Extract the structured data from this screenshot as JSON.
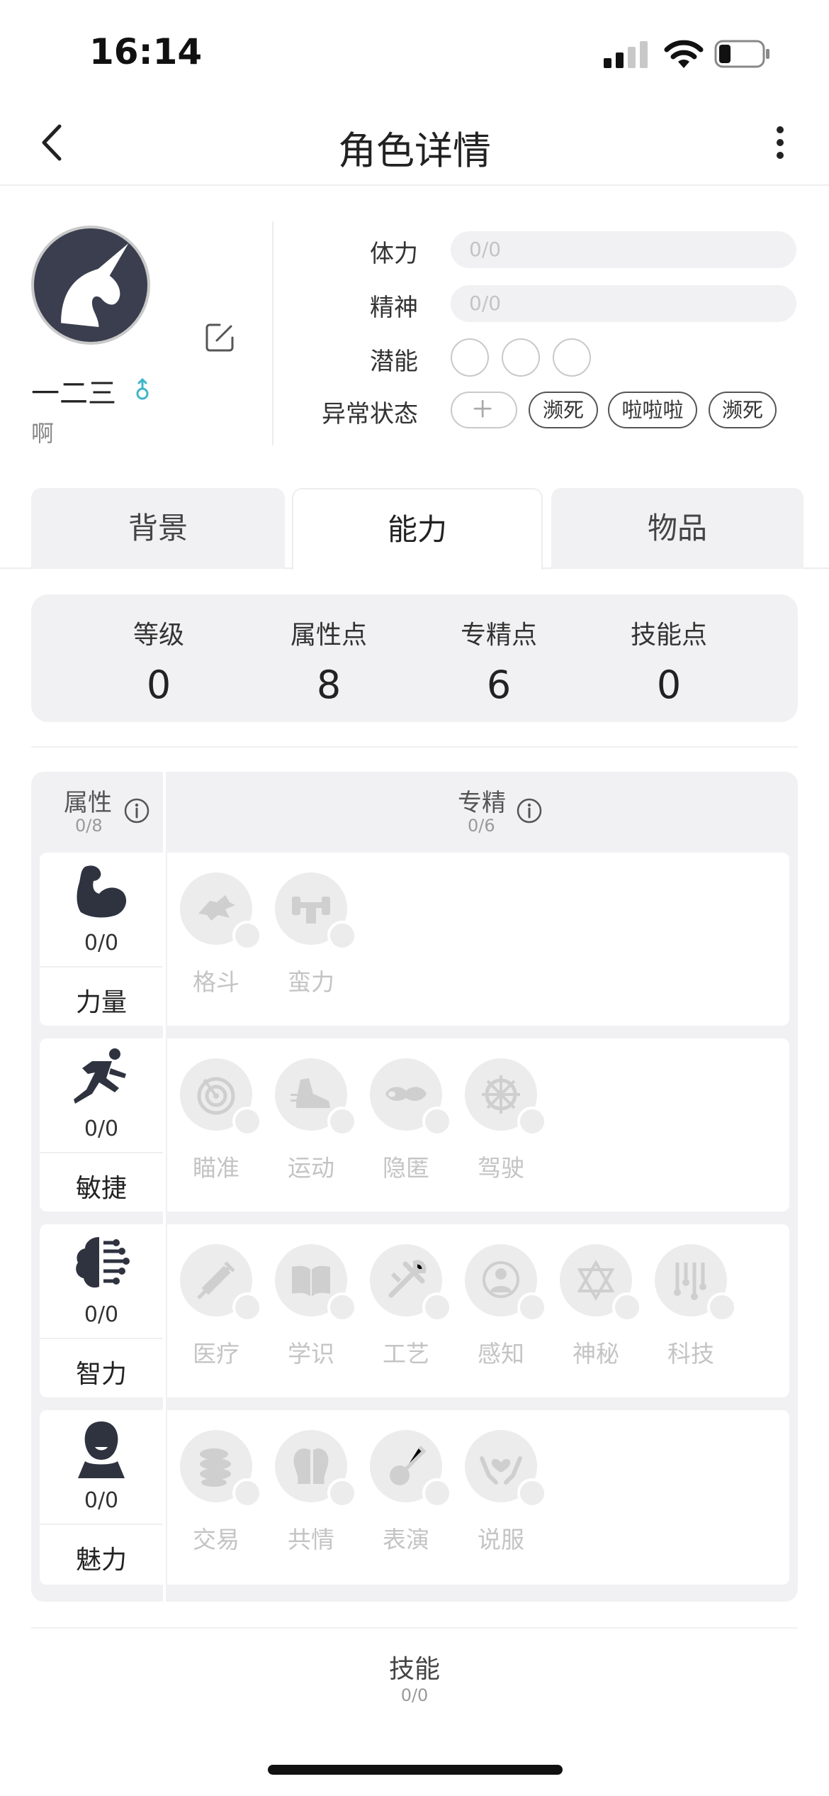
{
  "status_bar": {
    "time": "16:14"
  },
  "nav": {
    "title": "角色详情"
  },
  "profile": {
    "name": "一二三",
    "gender_symbol": "♂",
    "description": "啊"
  },
  "stats": {
    "stamina": {
      "label": "体力",
      "value": "0/0"
    },
    "spirit": {
      "label": "精神",
      "value": "0/0"
    },
    "potential": {
      "label": "潜能",
      "slots": 3
    },
    "status": {
      "label": "异常状态",
      "tags": [
        "濒死",
        "啦啦啦",
        "濒死"
      ]
    }
  },
  "tabs": [
    "背景",
    "能力",
    "物品"
  ],
  "active_tab": "能力",
  "summary": [
    {
      "label": "等级",
      "value": "0"
    },
    {
      "label": "属性点",
      "value": "8"
    },
    {
      "label": "专精点",
      "value": "6"
    },
    {
      "label": "技能点",
      "value": "0"
    }
  ],
  "grid": {
    "attr_header": {
      "title": "属性",
      "sub": "0/8"
    },
    "spec_header": {
      "title": "专精",
      "sub": "0/6"
    },
    "rows": [
      {
        "name": "力量",
        "value": "0/0",
        "icon": "muscle-icon",
        "skills": [
          {
            "name": "格斗",
            "icon": "fist-icon"
          },
          {
            "name": "蛮力",
            "icon": "weightlift-icon"
          }
        ]
      },
      {
        "name": "敏捷",
        "value": "0/0",
        "icon": "runner-icon",
        "skills": [
          {
            "name": "瞄准",
            "icon": "target-icon"
          },
          {
            "name": "运动",
            "icon": "sneaker-icon"
          },
          {
            "name": "隐匿",
            "icon": "mask-icon"
          },
          {
            "name": "驾驶",
            "icon": "steering-wheel-icon"
          }
        ]
      },
      {
        "name": "智力",
        "value": "0/0",
        "icon": "brain-icon",
        "skills": [
          {
            "name": "医疗",
            "icon": "syringe-icon"
          },
          {
            "name": "学识",
            "icon": "book-icon"
          },
          {
            "name": "工艺",
            "icon": "tools-icon"
          },
          {
            "name": "感知",
            "icon": "perception-icon"
          },
          {
            "name": "神秘",
            "icon": "hexagram-icon"
          },
          {
            "name": "科技",
            "icon": "circuit-icon"
          }
        ]
      },
      {
        "name": "魅力",
        "value": "0/0",
        "icon": "face-icon",
        "skills": [
          {
            "name": "交易",
            "icon": "coins-icon"
          },
          {
            "name": "共情",
            "icon": "empathy-icon"
          },
          {
            "name": "表演",
            "icon": "lute-icon"
          },
          {
            "name": "说服",
            "icon": "heart-hands-icon"
          }
        ]
      }
    ]
  },
  "skills_section": {
    "title": "技能",
    "sub": "0/0"
  }
}
